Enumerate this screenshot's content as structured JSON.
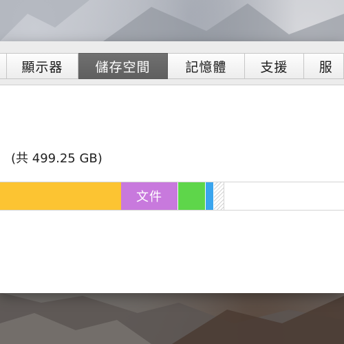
{
  "tabs": [
    {
      "label": "顯示器"
    },
    {
      "label": "儲存空間"
    },
    {
      "label": "記憶體"
    },
    {
      "label": "支援"
    },
    {
      "label": "服"
    }
  ],
  "active_tab": "儲存空間",
  "storage": {
    "capacity_text": "(共 499.25 GB)",
    "segments": {
      "documents_label": "文件"
    },
    "colors": {
      "apps": "#fcc432",
      "documents": "#c879dd",
      "photos": "#5ed64a",
      "system": "#3aa5ee",
      "free": "#ffffff"
    }
  },
  "theme": {
    "active_tab_bg": "#666666",
    "window_bg": "#ececec"
  }
}
